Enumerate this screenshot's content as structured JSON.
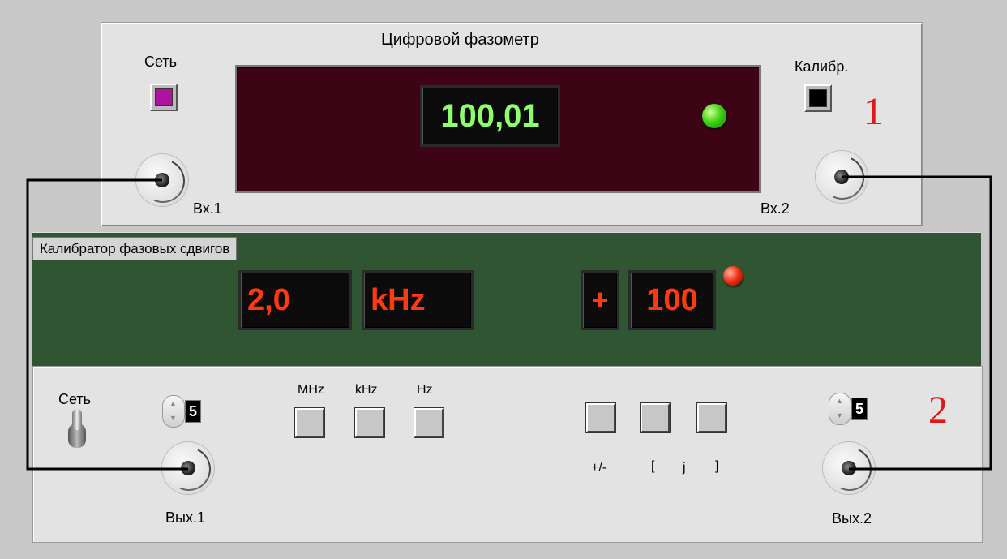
{
  "meter": {
    "title": "Цифровой фазометр",
    "power_label": "Сеть",
    "calib_label": "Калибр.",
    "display_value": "100,01",
    "input1_label": "Вх.1",
    "input2_label": "Вх.2",
    "marker": "1",
    "colors": {
      "screen": "#3d0416",
      "display_text": "#8cff6a",
      "power_button": "#b0129e",
      "led": "#3ed414"
    }
  },
  "calibrator": {
    "title": "Калибратор фазовых сдвигов",
    "frequency": "2,0",
    "frequency_unit": "kHz",
    "sign": "+",
    "phase": "100",
    "power_label": "Сеть",
    "unit_buttons": [
      "MHz",
      "kHz",
      "Hz"
    ],
    "entry_labels": [
      "+/-",
      "[",
      "j",
      "]"
    ],
    "stepper1_value": "5",
    "stepper2_value": "5",
    "output1_label": "Вых.1",
    "output2_label": "Вых.2",
    "marker": "2",
    "colors": {
      "panel": "#2f5532",
      "display_text": "#ff3a10",
      "led": "#ee2a10"
    }
  }
}
